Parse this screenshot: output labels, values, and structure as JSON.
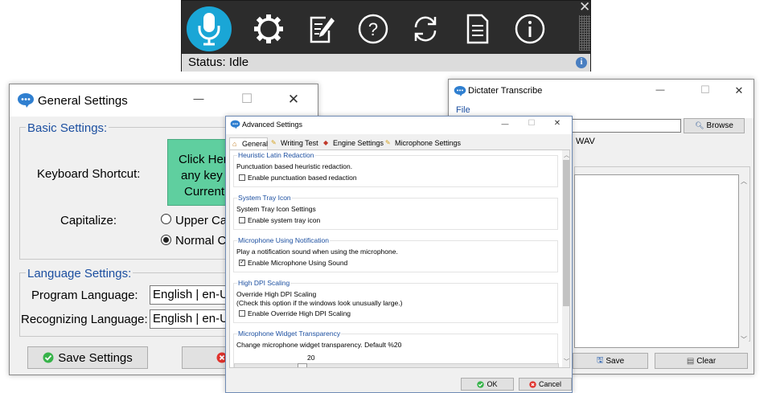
{
  "toolbar": {
    "status": "Status: Idle",
    "close_glyph": "✕",
    "icons": [
      "microphone-icon",
      "settings-gear-icon",
      "edit-note-icon",
      "help-icon",
      "refresh-icon",
      "document-icon",
      "info-icon"
    ],
    "info_small": "i",
    "accent_color": "#1aa6d6"
  },
  "general_settings": {
    "title": "General Settings",
    "basic_settings_label": "Basic Settings:",
    "keyboard_shortcut_label": "Keyboard Shortcut:",
    "shortcut_box_lines": [
      "Click Her",
      "any key c",
      "Current:"
    ],
    "shortcut_box_color": "#5fcf9f",
    "capitalize_label": "Capitalize:",
    "upper_case_option": "Upper Ca",
    "normal_case_option": "Normal C",
    "language_settings_label": "Language Settings:",
    "program_language_label": "Program Language:",
    "program_language_value": "English | en-U",
    "recognizing_language_label": "Recognizing Language:",
    "recognizing_language_value": "English | en-U",
    "save_button": "Save Settings",
    "min_glyph": "—",
    "max_glyph": "☐",
    "close_glyph": "✕"
  },
  "dictater_transcribe": {
    "title": "Dictater Transcribe",
    "file_menu": "File",
    "browse_button": "Browse",
    "format_text": "WAV",
    "save_button": "Save",
    "clear_button": "Clear",
    "min_glyph": "—",
    "max_glyph": "☐",
    "close_glyph": "✕"
  },
  "advanced_settings": {
    "title": "Advanced Settings",
    "tabs": [
      "General",
      "Writing Test",
      "Engine Settings",
      "Microphone Settings"
    ],
    "sections": [
      {
        "title": "Heuristic Latin Redaction",
        "text": "Punctuation based heuristic redaction.",
        "checkbox": "Enable punctuation based redaction",
        "checked": false
      },
      {
        "title": "System Tray Icon",
        "text": "System Tray Icon Settings",
        "checkbox": "Enable system tray icon",
        "checked": false
      },
      {
        "title": "Microphone Using Notification",
        "text": "Play a notification sound when using the microphone.",
        "checkbox": "Enable Microphone Using Sound",
        "checked": true
      },
      {
        "title": "High DPI Scaling",
        "text": "Override High DPI Scaling",
        "text2": "(Check this option if the windows look unusually large.)",
        "checkbox": "Enable Override High DPI Scaling",
        "checked": false
      },
      {
        "title": "Microphone Widget Transparency",
        "text": "Change microphone widget transparency. Default %20",
        "slider_value": "20",
        "slider_level": 20
      }
    ],
    "ok_button": "OK",
    "cancel_button": "Cancel",
    "min_glyph": "—",
    "max_glyph": "☐",
    "close_glyph": "✕"
  }
}
